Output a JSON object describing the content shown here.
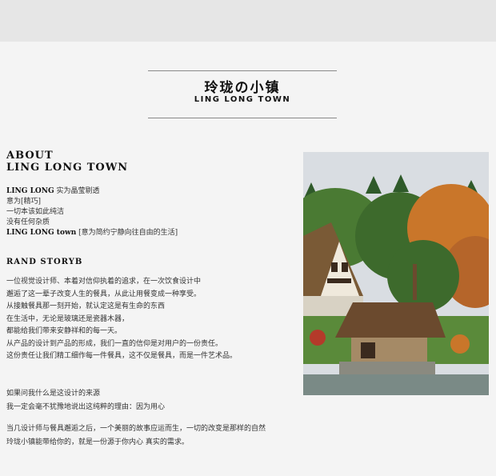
{
  "header": {
    "brand_cn": "玲珑の小镇",
    "brand_en": "LING LONG TOWN"
  },
  "about": {
    "title_line1": "ABOUT",
    "title_line2": "LING LONG TOWN",
    "intro": [
      {
        "bold": "LING LONG",
        "text": " 实为晶莹剔透"
      },
      {
        "bold": "",
        "text": "意为[精巧]"
      },
      {
        "bold": "",
        "text": "一切本该如此纯洁"
      },
      {
        "bold": "",
        "text": "没有任何杂质"
      },
      {
        "bold": "LING LONG town",
        "text": " [意为简约宁静向往自由的生活]"
      }
    ]
  },
  "brand_story": {
    "title": "RAND  STORYB",
    "lines": [
      "一位视觉设计师、本着对信仰执着的追求，在一次饮食设计中",
      "邂逅了这一辈子改变人生的餐具，从此让用餐变成一种享受。",
      "从接触餐具那一刻开始，就认定这是有生命的东西",
      "在生活中，无论是玻璃还是瓷器木器，",
      "都能给我们带来安静祥和的每一天。",
      "从产品的设计到产品的形成，我们一直的信仰是对用户的一份责任。",
      "这份责任让我们精工细作每一件餐具，这不仅是餐具，而是一件艺术品。"
    ]
  },
  "question": {
    "lines": [
      "如果问我什么是这设计的来源",
      "我一定会毫不犹豫地说出这纯粹的理由：因为用心"
    ]
  },
  "ending": {
    "lines": [
      "当几设计师与餐具邂逅之后，一个美丽的故事应运而生，一切的改变是那样的自然",
      "玲珑小镇能带给你的，就是一份源于你内心      真实的需求。"
    ]
  },
  "colors": {
    "sky": "#d9dde2",
    "roof": "#6b4a2e",
    "foliage_orange": "#c9762a",
    "foliage_green": "#3d6a2c",
    "water": "#7a8a86"
  },
  "photo": {
    "icon": "thatched-village-photo"
  }
}
